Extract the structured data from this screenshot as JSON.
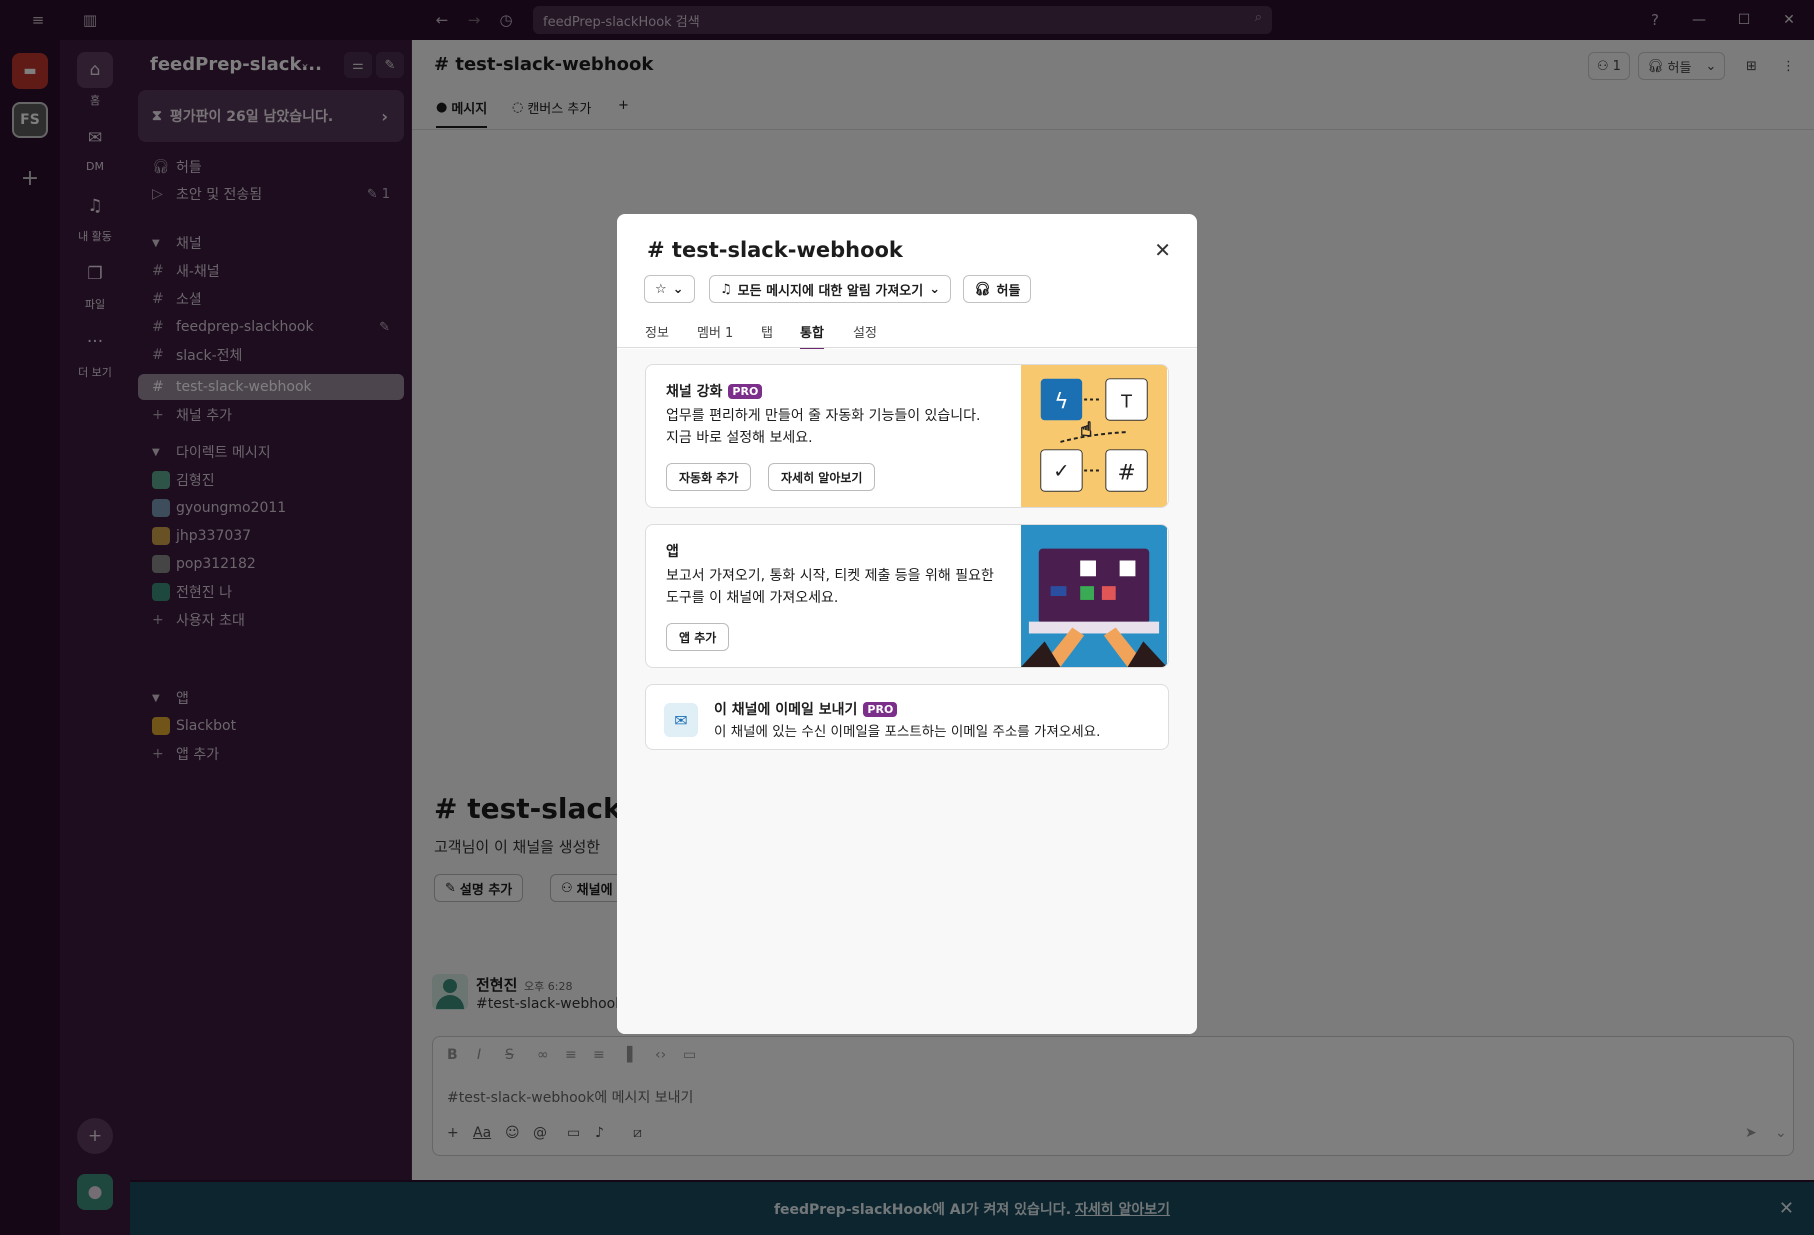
{
  "titlebar": {
    "search_placeholder": "feedPrep-slackHook 검색"
  },
  "rail": {
    "workspace_initials": "FS"
  },
  "nav": {
    "items": [
      {
        "label": "홈"
      },
      {
        "label": "DM"
      },
      {
        "label": "내 활동"
      },
      {
        "label": "파일"
      },
      {
        "label": "더 보기"
      }
    ]
  },
  "sidebar": {
    "workspace_name": "feedPrep-slack...",
    "trial_text": "평가판이 26일 남았습니다.",
    "huddle": "허들",
    "drafts": "초안 및 전송됨",
    "drafts_count": "1",
    "channels_header": "채널",
    "channels": [
      "새-채널",
      "소셜",
      "feedprep-slackhook",
      "slack-전체",
      "test-slack-webhook"
    ],
    "add_channel": "채널 추가",
    "dm_header": "다이렉트 메시지",
    "dms": [
      "김형진",
      "gyoungmo2011",
      "jhp337037",
      "pop312182",
      "전현진  나"
    ],
    "invite": "사용자 초대",
    "apps_header": "앱",
    "apps": [
      "Slackbot"
    ],
    "add_app": "앱 추가"
  },
  "main": {
    "channel_title": "# test-slack-webhook",
    "tab_messages": "메시지",
    "tab_canvas": "캔버스 추가",
    "member_count": "1",
    "huddle_btn": "허들",
    "big_title": "# test-slack-w",
    "intro_text": "고객님이 이 채널을 생성한",
    "add_desc_btn": "설명 추가",
    "add_people_btn": "채널에",
    "msg_author": "전현진",
    "msg_time": "오후 6:28",
    "msg_text": "#test-slack-webhook",
    "composer_placeholder": "#test-slack-webhook에 메시지 보내기"
  },
  "banner": {
    "text": "feedPrep-slackHook에 AI가 켜져 있습니다.",
    "link": "자세히 알아보기"
  },
  "modal": {
    "title": "# test-slack-webhook",
    "notif_btn": "모든 메시지에 대한 알림 가져오기",
    "huddle_btn": "허들",
    "tabs": [
      "정보",
      "멤버 1",
      "탭",
      "통합",
      "설정"
    ],
    "active_tab": "통합",
    "card1": {
      "title": "채널 강화",
      "badge": "PRO",
      "desc": "업무를 편리하게 만들어 줄 자동화 기능들이 있습니다. 지금 바로 설정해 보세요.",
      "btn1": "자동화 추가",
      "btn2": "자세히 알아보기"
    },
    "card2": {
      "title": "앱",
      "desc": "보고서 가져오기, 통화 시작, 티켓 제출 등을 위해 필요한 도구를 이 채널에 가져오세요.",
      "btn": "앱 추가"
    },
    "card3": {
      "title": "이 채널에 이메일 보내기",
      "badge": "PRO",
      "desc": "이 채널에 있는 수신 이메일을 포스트하는 이메일 주소를 가져오세요."
    }
  },
  "colors": {
    "aubergine": "#3a1a3d",
    "pro_badge": "#7b2f8a",
    "banner": "#1a4a5e"
  }
}
